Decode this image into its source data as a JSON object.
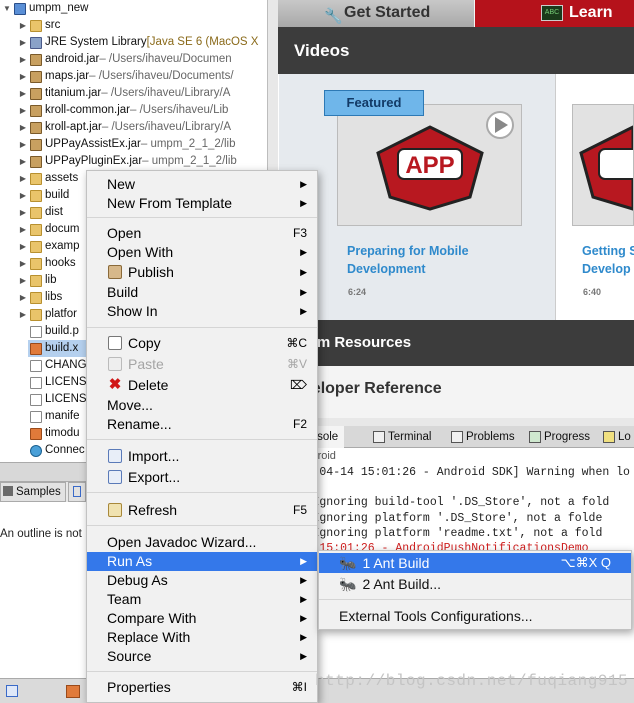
{
  "tree": {
    "items": [
      {
        "label": "umpm_new",
        "meta": "",
        "icon": "project",
        "top": 0
      },
      {
        "label": "src",
        "meta": "",
        "icon": "folder"
      },
      {
        "label": "JRE System Library",
        "meta": "[Java SE 6 (MacOS X",
        "icon": "lib"
      },
      {
        "label": "android.jar",
        "meta": " – /Users/ihaveu/Documen",
        "icon": "jar"
      },
      {
        "label": "maps.jar",
        "meta": " – /Users/ihaveu/Documents/",
        "icon": "jar"
      },
      {
        "label": "titanium.jar",
        "meta": " – /Users/ihaveu/Library/A",
        "icon": "jar"
      },
      {
        "label": "kroll-common.jar",
        "meta": " – /Users/ihaveu/Lib",
        "icon": "jar"
      },
      {
        "label": "kroll-apt.jar",
        "meta": " – /Users/ihaveu/Library/A",
        "icon": "jar"
      },
      {
        "label": "UPPayAssistEx.jar",
        "meta": " – umpm_2_1_2/lib",
        "icon": "jar"
      },
      {
        "label": "UPPayPluginEx.jar",
        "meta": " – umpm_2_1_2/lib",
        "icon": "jar"
      },
      {
        "label": "assets",
        "meta": "",
        "icon": "folder"
      },
      {
        "label": "build",
        "meta": "",
        "icon": "folder"
      },
      {
        "label": "dist",
        "meta": "",
        "icon": "folder"
      },
      {
        "label": "docum",
        "meta": "",
        "icon": "folder"
      },
      {
        "label": "examp",
        "meta": "",
        "icon": "folder"
      },
      {
        "label": "hooks",
        "meta": "",
        "icon": "folder"
      },
      {
        "label": "lib",
        "meta": "",
        "icon": "folder"
      },
      {
        "label": "libs",
        "meta": "",
        "icon": "folder"
      },
      {
        "label": "platfor",
        "meta": "",
        "icon": "folder"
      },
      {
        "label": "build.p",
        "meta": "",
        "icon": "file"
      },
      {
        "label": "build.x",
        "meta": "",
        "icon": "xml"
      },
      {
        "label": "CHANG",
        "meta": "",
        "icon": "file"
      },
      {
        "label": "LICENS",
        "meta": "",
        "icon": "file"
      },
      {
        "label": "LICENS",
        "meta": "",
        "icon": "file"
      },
      {
        "label": "manife",
        "meta": "",
        "icon": "file"
      },
      {
        "label": "timodu",
        "meta": "",
        "icon": "xml"
      },
      {
        "label": "Connec",
        "meta": "",
        "icon": "globe"
      }
    ]
  },
  "bottom_left": {
    "samples_tab": "Samples",
    "outline_msg": "An outline is not"
  },
  "welcome": {
    "tab_get_started": "Get Started",
    "tab_learn": "Learn",
    "videos_heading": "Videos",
    "featured_badge": "Featured",
    "app_logo_text": "APP",
    "video1_title_line1": "Preparing for Mobile",
    "video1_title_line2": "Development",
    "video1_duration": "6:24",
    "video2_title_line1": "Getting S",
    "video2_title_line2": "Develop",
    "video2_duration": "6:40",
    "resources_heading": "anium Resources",
    "developer_reference": "eveloper Reference"
  },
  "console": {
    "tabs": [
      "Console",
      "Terminal",
      "Problems",
      "Progress",
      "Lo"
    ],
    "subtitle": "Android",
    "lines": [
      "[2014-04-14 15:01:26 - Android SDK] Warning when lo",
      "ing: Ignoring build-tool '.DS_Store', not a fold",
      "ing: Ignoring platform '.DS_Store', not a folde",
      "ing: Ignoring platform 'readme.txt', not a fold",
      "04-14 15:01:26 - AndroidPushNotificationsDemo"
    ]
  },
  "context_menu": {
    "new": "New",
    "new_from_template": "New From Template",
    "open": "Open",
    "open_sc": "F3",
    "open_with": "Open With",
    "publish": "Publish",
    "build": "Build",
    "show_in": "Show In",
    "copy": "Copy",
    "copy_sc": "⌘C",
    "paste": "Paste",
    "paste_sc": "⌘V",
    "delete": "Delete",
    "delete_sc": "⌦",
    "move": "Move...",
    "rename": "Rename...",
    "rename_sc": "F2",
    "import": "Import...",
    "export": "Export...",
    "refresh": "Refresh",
    "refresh_sc": "F5",
    "open_javadoc": "Open Javadoc Wizard...",
    "run_as": "Run As",
    "debug_as": "Debug As",
    "team": "Team",
    "compare_with": "Compare With",
    "replace_with": "Replace With",
    "source": "Source",
    "properties": "Properties",
    "properties_sc": "⌘I"
  },
  "submenu": {
    "ant_build_1": "1 Ant Build",
    "ant_build_1_sc": "⌥⌘X Q",
    "ant_build_2": "2 Ant Build...",
    "external_tools": "External Tools Configurations..."
  },
  "watermark": "http://blog.csdn.net/fuqiang915",
  "colors": {
    "menu_highlight": "#3478ea",
    "learn_tab": "#b5121b",
    "link_blue": "#2f8acc"
  }
}
